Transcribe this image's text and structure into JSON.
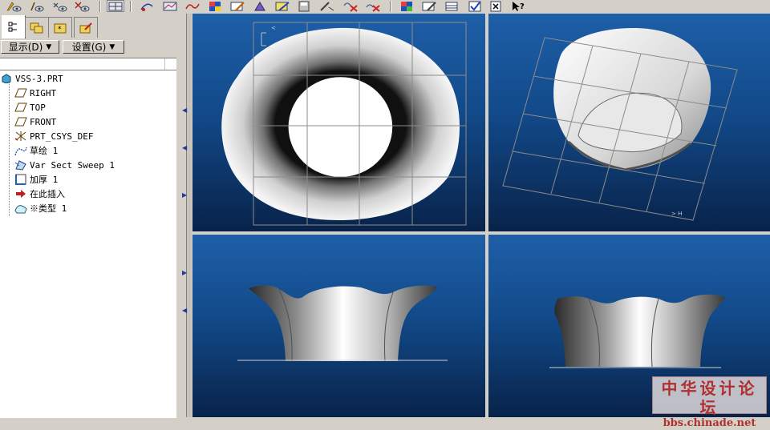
{
  "panel": {
    "display_menu": "显示(D)",
    "settings_menu": "设置(G)"
  },
  "tree": {
    "root": "VSS-3.PRT",
    "items": [
      {
        "label": "RIGHT",
        "icon": "datum-plane-icon"
      },
      {
        "label": "TOP",
        "icon": "datum-plane-icon"
      },
      {
        "label": "FRONT",
        "icon": "datum-plane-icon"
      },
      {
        "label": "PRT_CSYS_DEF",
        "icon": "csys-icon"
      },
      {
        "label": "草绘 1",
        "icon": "sketch-icon"
      },
      {
        "label": "Var Sect Sweep 1",
        "icon": "sweep-icon"
      },
      {
        "label": "加厚 1",
        "icon": "thicken-icon"
      },
      {
        "label": "在此插入",
        "icon": "insert-here-icon"
      },
      {
        "label": "※类型 1",
        "icon": "style-icon"
      }
    ]
  },
  "watermark": {
    "line1": "中华设计论坛",
    "line2": "bbs.chinade.net"
  },
  "colors": {
    "viewport_top": "#1e5fa8",
    "viewport_bottom": "#08234a",
    "watermark_text": "#b03030"
  }
}
